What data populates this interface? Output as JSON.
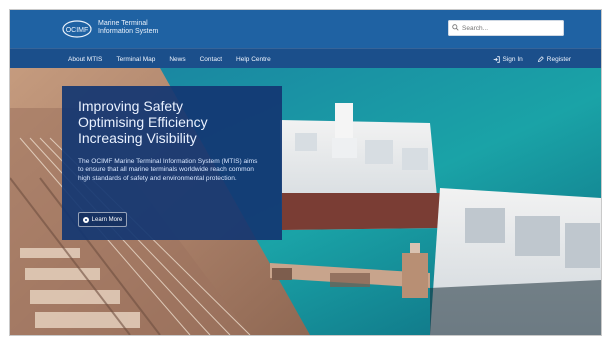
{
  "header": {
    "logo_text": "OCIMF",
    "brand_line1": "Marine Terminal",
    "brand_line2": "Information System",
    "search_placeholder": "Search..."
  },
  "nav": {
    "items": [
      "About MTIS",
      "Terminal Map",
      "News",
      "Contact",
      "Help Centre"
    ],
    "signin": "Sign In",
    "register": "Register"
  },
  "hero": {
    "title_lines": [
      "Improving Safety",
      "Optimising Efficiency",
      "Increasing Visibility"
    ],
    "body": "The OCIMF Marine Terminal Information System (MTIS) aims to ensure that all marine terminals worldwide reach common high standards of safety and environmental protection.",
    "button_label": "Learn More"
  }
}
